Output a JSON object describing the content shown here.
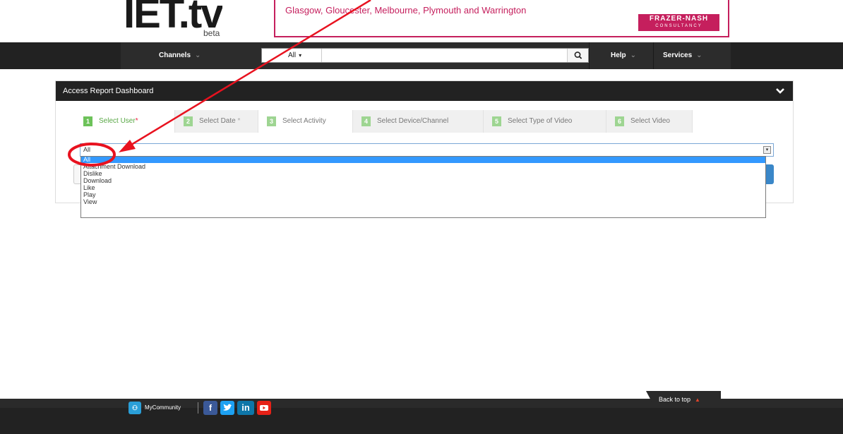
{
  "header": {
    "logo_text": "IET.tv",
    "logo_beta": "beta",
    "banner_text": "Glasgow, Gloucester, Melbourne, Plymouth and Warrington",
    "banner_brand_line1": "FRAZER-NASH",
    "banner_brand_line2": "CONSULTANCY"
  },
  "nav": {
    "channels": "Channels",
    "search_scope": "All",
    "search_placeholder": "",
    "help": "Help",
    "services": "Services"
  },
  "panel": {
    "title": "Access Report Dashboard",
    "tabs": [
      {
        "num": "1",
        "label": "Select User",
        "required": "*"
      },
      {
        "num": "2",
        "label": "Select Date",
        "required": "*"
      },
      {
        "num": "3",
        "label": "Select Activity"
      },
      {
        "num": "4",
        "label": "Select Device/Channel"
      },
      {
        "num": "5",
        "label": "Select Type of Video"
      },
      {
        "num": "6",
        "label": "Select Video"
      }
    ],
    "activity_select": {
      "value": "All",
      "options": [
        "All",
        "Attachment Download",
        "Dislike",
        "Download",
        "Like",
        "Play",
        "View"
      ],
      "selected_index": 0
    }
  },
  "footer": {
    "community": "MyCommunity",
    "back_to_top": "Back to top",
    "social": [
      "facebook",
      "twitter",
      "linkedin",
      "youtube"
    ]
  },
  "colors": {
    "annotation_red": "#e8121f",
    "accent_green": "#6dc25a",
    "brand_pink": "#c51f5d",
    "select_blue": "#3399ff"
  }
}
